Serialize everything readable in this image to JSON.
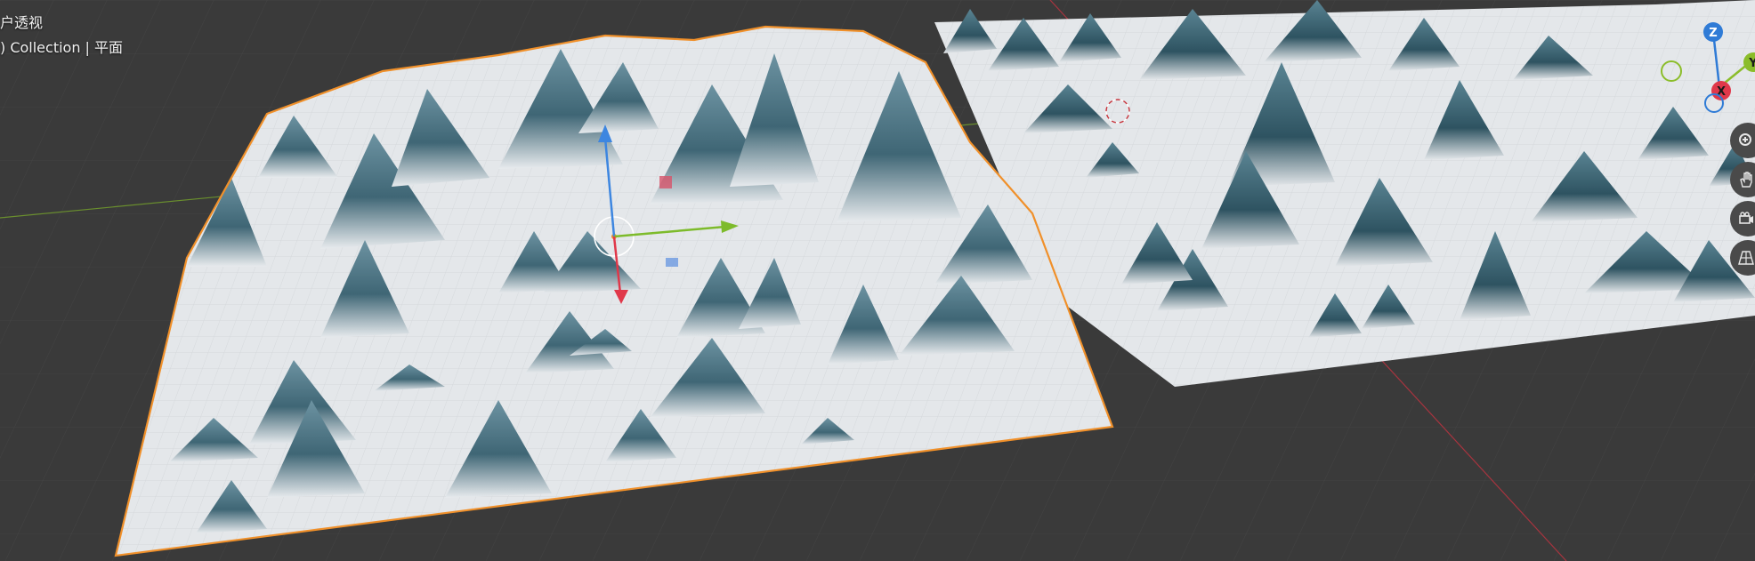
{
  "overlay": {
    "view_name": "户透视",
    "collection_line": ") Collection | 平面"
  },
  "gizmo": {
    "z_label": "Z",
    "x_label": "X",
    "y_label": "Y",
    "colors": {
      "x": "#e0384a",
      "y": "#8bbd2a",
      "z": "#2f7bd6"
    }
  },
  "nav_tools": [
    {
      "name": "zoom-icon"
    },
    {
      "name": "pan-hand-icon"
    },
    {
      "name": "camera-icon"
    },
    {
      "name": "grid-perspective-icon"
    }
  ],
  "colors": {
    "background": "#3a3a3a",
    "selection_outline": "#f0902a",
    "terrain_snow": "#e6e9ec",
    "terrain_rock": "#4e7585"
  }
}
